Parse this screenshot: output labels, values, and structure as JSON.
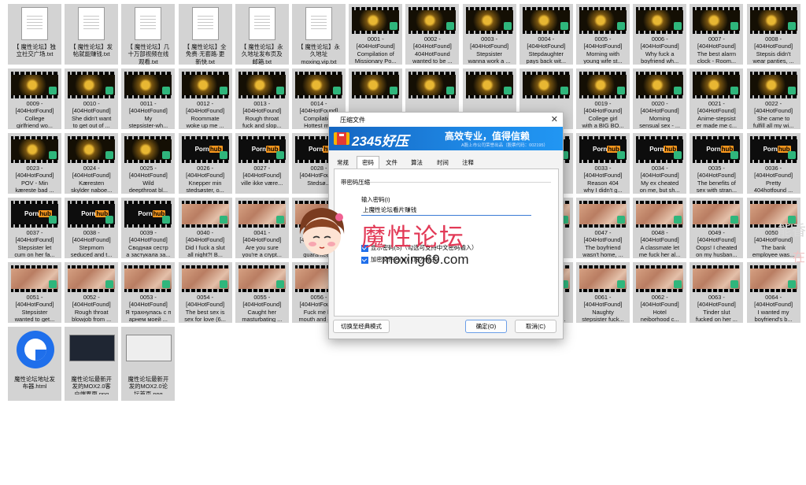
{
  "files": [
    {
      "kind": "doc",
      "label": "【 魔性论坛】独\n立社交广场.txt"
    },
    {
      "kind": "doc",
      "label": "【 魔性论坛】发\n帖就能赚钱.txt"
    },
    {
      "kind": "doc",
      "label": "【 魔性论坛】几\n十万部视频在线\n观看.txt"
    },
    {
      "kind": "doc",
      "label": "【 魔性论坛】全\n免费·无套路·更\n新快.txt"
    },
    {
      "kind": "doc",
      "label": "【 魔性论坛】永\n久地址发布页及\n邮箱.txt"
    },
    {
      "kind": "doc",
      "label": "【 魔性论坛】永\n久地址\nmoxing.vip.txt"
    },
    {
      "kind": "gold",
      "label": "0001 -\n[404HotFound]\nCompilation of\nMissionary Po..."
    },
    {
      "kind": "gold",
      "label": "0002 -\n[404HotFound]\n404HotFound\nwanted to be ..."
    },
    {
      "kind": "gold",
      "label": "0003 -\n[404HotFound]\nStepsister\nwanna work a ..."
    },
    {
      "kind": "gold",
      "label": "0004 -\n[404HotFound]\nStepdaughter\npays back wit..."
    },
    {
      "kind": "gold",
      "label": "0005 -\n[404HotFound]\nMorning with\nyoung wife st..."
    },
    {
      "kind": "gold",
      "label": "0006 -\n[404HotFound]\nWhy fuck a\nboyfriend wh..."
    },
    {
      "kind": "gold",
      "label": "0007 -\n[404HotFound]\nThe best alarm\nclock - Room..."
    },
    {
      "kind": "gold",
      "label": "0008 -\n[404HotFound]\nStepsis didn't\nwear panties, ..."
    },
    {
      "kind": "gold",
      "label": "0009 -\n[404HotFound]\nCollege\ngirlfriend  wo..."
    },
    {
      "kind": "gold",
      "label": "0010 -\n[404HotFound]\nShe didn't want\nto get out of ..."
    },
    {
      "kind": "gold",
      "label": "0011 -\n[404HotFound]\nMy\nstepsister-wh..."
    },
    {
      "kind": "gold",
      "label": "0012 -\n[404HotFound]\nRoommate\nwoke up me ..."
    },
    {
      "kind": "gold",
      "label": "0013 -\n[404HotFound]\nRough throat\nfuck and slop..."
    },
    {
      "kind": "gold",
      "label": "0014 -\n[404HotFound]\nCompilation\nHottest m..."
    },
    {
      "kind": "gold",
      "label": ""
    },
    {
      "kind": "gold",
      "label": ""
    },
    {
      "kind": "gold",
      "label": ""
    },
    {
      "kind": "gold",
      "label": ""
    },
    {
      "kind": "gold",
      "label": "0019 -\n[404HotFound]\nCollege girl\nwith a BIG BO..."
    },
    {
      "kind": "gold",
      "label": "0020 -\n[404HotFound]\nMorning\nsensual sex - ..."
    },
    {
      "kind": "gold",
      "label": "0021 -\n[404HotFound]\nAnime-stepsist\ner made me c..."
    },
    {
      "kind": "gold",
      "label": "0022 -\n[404HotFound]\nShe came to\nfulfill all my wi..."
    },
    {
      "kind": "gold",
      "label": "0023 -\n[404HotFound]\nPOV - Min\nkæreste bad ..."
    },
    {
      "kind": "gold",
      "label": "0024 -\n[404HotFound]\nKæresten\nskylder naboe..."
    },
    {
      "kind": "gold",
      "label": "0025 -\n[404HotFound]\nWild\ndeepthroat bl..."
    },
    {
      "kind": "ph",
      "label": "0026 -\n[404HotFound]\nKnepper min\nstedsøster, o..."
    },
    {
      "kind": "ph",
      "label": "0027 -\n[404HotFound]\nville ikke være..."
    },
    {
      "kind": "ph",
      "label": "0028 -\n[404HotFound]\nStedsø..."
    },
    {
      "kind": "ph",
      "label": ""
    },
    {
      "kind": "ph",
      "label": ""
    },
    {
      "kind": "ph",
      "label": ""
    },
    {
      "kind": "ph",
      "label": ""
    },
    {
      "kind": "ph",
      "label": "0033 -\n[404HotFound]\nReason 404\nwhy I didn't g..."
    },
    {
      "kind": "ph",
      "label": "0034 -\n[404HotFound]\nMy ex cheated\non me, but sh..."
    },
    {
      "kind": "ph",
      "label": "0035 -\n[404HotFound]\nThe benefits of\nsex with stran..."
    },
    {
      "kind": "ph",
      "label": "0036 -\n[404HotFound]\nPretty\n404hotfound ..."
    },
    {
      "kind": "ph",
      "label": "0037 -\n[404HotFound]\nStepsister let\ncum on her fa..."
    },
    {
      "kind": "ph",
      "label": "0038 -\n[404HotFound]\nStepmom\nseduced and t..."
    },
    {
      "kind": "ph",
      "label": "0039 -\n[404HotFound]\nСводная сестр\nа застукала за..."
    },
    {
      "kind": "skin",
      "label": "0040 -\n[404HotFound]\nDid I fuck a slut\nall night?! B..."
    },
    {
      "kind": "skin",
      "label": "0041 -\n[404HotFound]\nAre you sure\nyou're a crypt..."
    },
    {
      "kind": "skin",
      "label": "0042 -\n[404HotFound]\nRou...\nguarantee..."
    },
    {
      "kind": "skin",
      "label": ""
    },
    {
      "kind": "skin",
      "label": ""
    },
    {
      "kind": "skin",
      "label": ""
    },
    {
      "kind": "skin",
      "label": ""
    },
    {
      "kind": "skin",
      "label": "0047 -\n[404HotFound]\nThe boyfriend\nwasn't home, ..."
    },
    {
      "kind": "skin",
      "label": "0048 -\n[404HotFound]\nA classmate let\nme fuck her al..."
    },
    {
      "kind": "skin",
      "label": "0049 -\n[404HotFound]\nOops! I cheated\non my husban..."
    },
    {
      "kind": "skin",
      "label": "0050 -\n[404HotFound]\nThe bank\nemployee was..."
    },
    {
      "kind": "skin",
      "label": "0051 -\n[404HotFound]\nStepsister\nwanted to get..."
    },
    {
      "kind": "skin",
      "label": "0052 -\n[404HotFound]\nRough throat\nblowjob from ..."
    },
    {
      "kind": "skin",
      "label": "0053 -\n[404HotFound]\nЯ трахнулась с п\nарнем моей ..."
    },
    {
      "kind": "skin",
      "label": "0054 -\n[404HotFound]\nThe best sex is\nsex for love (6..."
    },
    {
      "kind": "skin",
      "label": "0055 -\n[404HotFound]\nCaught her\nmasturbating ..."
    },
    {
      "kind": "skin",
      "label": "0056 -\n[404HotFound]\nFuck me ha\nmouth and cu..."
    },
    {
      "kind": "skin",
      "label": "\n\n\nthe guy to fin..."
    },
    {
      "kind": "skin",
      "label": "\n\n\nto him and it ..."
    },
    {
      "kind": "skin",
      "label": "\n\n\nmy dick and w..."
    },
    {
      "kind": "skin",
      "label": "\n\n\nread a book, ..."
    },
    {
      "kind": "skin",
      "label": "0061 -\n[404HotFound]\nNaughty\nstepsister fuck..."
    },
    {
      "kind": "skin",
      "label": "0062 -\n[404HotFound]\nHotel\nneiborhood c..."
    },
    {
      "kind": "skin",
      "label": "0063 -\n[404HotFound]\nTinder slut\nfucked on her ..."
    },
    {
      "kind": "skin",
      "label": "0064 -\n[404HotFound]\nI wanted my\nboyfriend's b..."
    },
    {
      "kind": "html",
      "label": "魔性论坛地址发\n布器.html"
    },
    {
      "kind": "png",
      "label": "魔性论坛最新开\n发的MOX2.0客\n户端界面.png"
    },
    {
      "kind": "png-light",
      "label": "魔性论坛最新开\n发的MOX2.0论\n坛首页.png"
    }
  ],
  "thumb_brand": {
    "left": "Porn",
    "right": "hub"
  },
  "dialog": {
    "title": "压缩文件",
    "close_glyph": "✕",
    "brand": "2345好压",
    "slogan": "高效专业，值得信赖",
    "subtitle": "A股上市公司荣誉出品（股票代码：002195）",
    "tabs": [
      "常规",
      "密码",
      "文件",
      "算法",
      "时间",
      "注释"
    ],
    "active_tab": 1,
    "section_title": "带密码压缩",
    "password_label": "输入密码(I)",
    "password_value": "上魔性论坛看片赚钱",
    "checkbox_show": "显示密码(S)（勾选可支持中文密码输入）",
    "checkbox_encrypt": "加密文件名(N)（限7z格式）",
    "switch_button": "切换至经典模式",
    "ok_button": "确定(O)",
    "cancel_button": "取消(C)"
  },
  "watermark": {
    "text": "魔性论坛",
    "url": "moxing69.com"
  },
  "edge_text": {
    "gray": "能香",
    "red": "在"
  },
  "colors": {
    "tile_bg": "#d3d3d3",
    "banner": "#1e88e5",
    "accent": "#1f6feb",
    "watermark": "#e23a57"
  }
}
